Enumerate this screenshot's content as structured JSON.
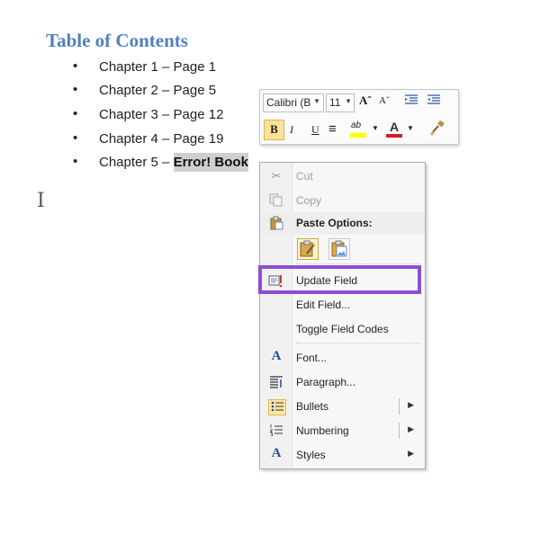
{
  "document": {
    "title": "Table of Contents",
    "items": [
      {
        "label": "Chapter 1 – Page 1"
      },
      {
        "label": "Chapter 2 – Page 5"
      },
      {
        "label": "Chapter 3 – Page 12"
      },
      {
        "label": "Chapter 4 – Page 19"
      },
      {
        "label": "Chapter 5 – ",
        "error_field": "Error! Book"
      }
    ],
    "bullet": "•",
    "cursor": "I"
  },
  "mini_toolbar": {
    "font_name": "Calibri (B",
    "font_size": "11",
    "grow_font": "Aˆ",
    "shrink_font": "Aˇ",
    "bold": "B",
    "italic": "I",
    "underline": "U",
    "center": "≡",
    "highlight_label": "ab",
    "font_color_label": "A",
    "highlight_color": "#ffff00",
    "font_color": "#d02020"
  },
  "context_menu": {
    "items": [
      {
        "label": "Cut",
        "icon": "scissors-icon",
        "disabled": true
      },
      {
        "label": "Copy",
        "icon": "copy-icon",
        "disabled": true
      },
      {
        "label": "Paste Options:",
        "icon": "clipboard-icon"
      },
      {
        "label": "Update Field",
        "icon": "update-field-icon",
        "highlighted": true
      },
      {
        "label": "Edit Field...",
        "icon": ""
      },
      {
        "label": "Toggle Field Codes",
        "icon": ""
      },
      {
        "label": "Font...",
        "icon": "font-icon"
      },
      {
        "label": "Paragraph...",
        "icon": "paragraph-icon"
      },
      {
        "label": "Bullets",
        "icon": "bullets-icon",
        "submenu": true,
        "split": true
      },
      {
        "label": "Numbering",
        "icon": "numbering-icon",
        "submenu": true,
        "split": true
      },
      {
        "label": "Styles",
        "icon": "styles-icon",
        "submenu": true
      }
    ],
    "highlight_color": "#8a4fd1"
  }
}
